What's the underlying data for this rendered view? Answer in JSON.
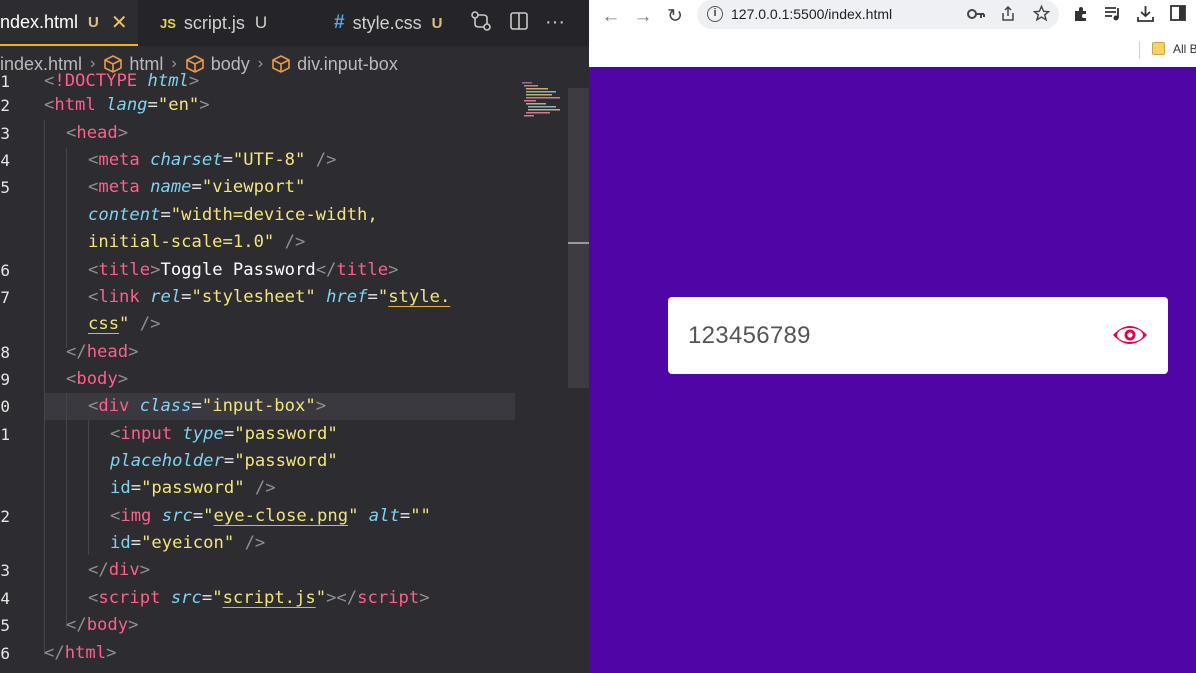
{
  "editor": {
    "tabs": [
      {
        "label": "index.html",
        "status": "U",
        "close": "✕"
      },
      {
        "label": "script.js",
        "badge": "JS",
        "status": "U"
      },
      {
        "label": "style.css",
        "badge": "#",
        "status": "U"
      }
    ],
    "more_label": "···",
    "breadcrumb": [
      "index.html",
      "html",
      "body",
      "div.input-box"
    ],
    "line_numbers": [
      "1",
      "2",
      "3",
      "4",
      "5",
      "",
      "",
      "6",
      "7",
      "",
      "8",
      "9",
      "0",
      "1",
      "",
      "",
      "2",
      "",
      "3",
      "4",
      "5",
      "6"
    ]
  },
  "browser": {
    "url": "127.0.0.1:5500/index.html",
    "bookmarks_label": "All B",
    "password_value": "123456789"
  },
  "colors": {
    "page_background": "#5005a6",
    "eye_icon": "#e3004f"
  }
}
